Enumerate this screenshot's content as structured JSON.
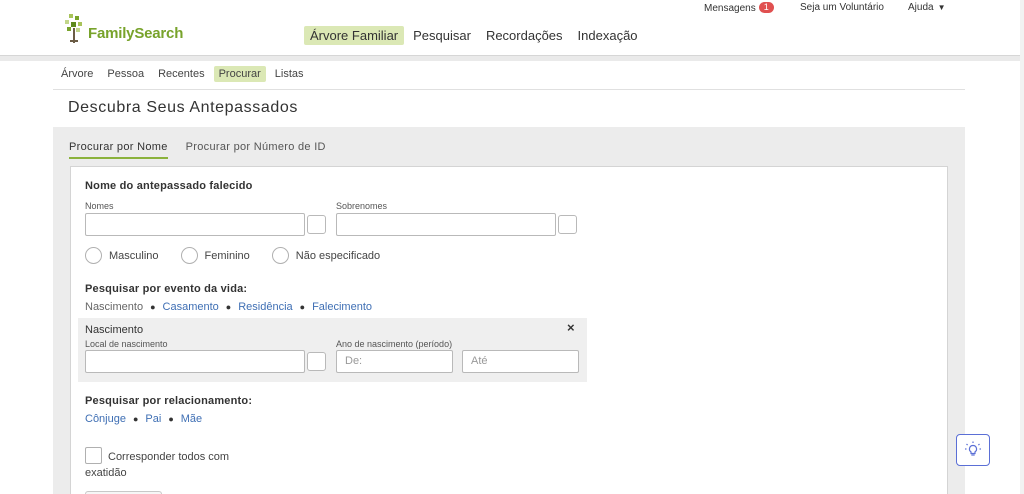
{
  "header": {
    "messages_label": "Mensagens",
    "messages_count": "1",
    "volunteer_label": "Seja um Voluntário",
    "help_label": "Ajuda",
    "logo_text": "FamilySearch"
  },
  "main_nav": [
    {
      "label": "Árvore Familiar",
      "active": true
    },
    {
      "label": "Pesquisar",
      "active": false
    },
    {
      "label": "Recordações",
      "active": false
    },
    {
      "label": "Indexação",
      "active": false
    }
  ],
  "sub_nav": [
    {
      "label": "Árvore",
      "active": false
    },
    {
      "label": "Pessoa",
      "active": false
    },
    {
      "label": "Recentes",
      "active": false
    },
    {
      "label": "Procurar",
      "active": true
    },
    {
      "label": "Listas",
      "active": false
    }
  ],
  "page_title": "Descubra Seus Antepassados",
  "tabs": [
    {
      "label": "Procurar por Nome",
      "active": true
    },
    {
      "label": "Procurar por Número de ID",
      "active": false
    }
  ],
  "form": {
    "ancestor_heading": "Nome do antepassado falecido",
    "first_names_label": "Nomes",
    "first_names_value": "",
    "surnames_label": "Sobrenomes",
    "surnames_value": "",
    "gender_options": [
      "Masculino",
      "Feminino",
      "Não especificado"
    ],
    "life_event_heading": "Pesquisar por evento da vida:",
    "life_events": [
      {
        "label": "Nascimento",
        "current": true
      },
      {
        "label": "Casamento",
        "current": false
      },
      {
        "label": "Residência",
        "current": false
      },
      {
        "label": "Falecimento",
        "current": false
      }
    ],
    "birth": {
      "title": "Nascimento",
      "close_symbol": "×",
      "place_label": "Local de nascimento",
      "place_value": "",
      "year_label": "Ano de nascimento (período)",
      "from_placeholder": "De:",
      "to_placeholder": "Até"
    },
    "relationship_heading": "Pesquisar por relacionamento:",
    "relationships": [
      "Cônjuge",
      "Pai",
      "Mãe"
    ],
    "exact_match_label": "Corresponder todos com exatidão"
  },
  "colors": {
    "brand_green": "#78a32b",
    "active_nav_bg": "#dbe8b5",
    "link_blue": "#3f6fb4",
    "badge_red": "#e05050",
    "tip_border": "#5b6fd6"
  },
  "icons": {
    "logo": "familysearch-tree-icon",
    "tip": "lightbulb-icon",
    "close": "close-icon",
    "help_caret": "caret-down-icon"
  }
}
